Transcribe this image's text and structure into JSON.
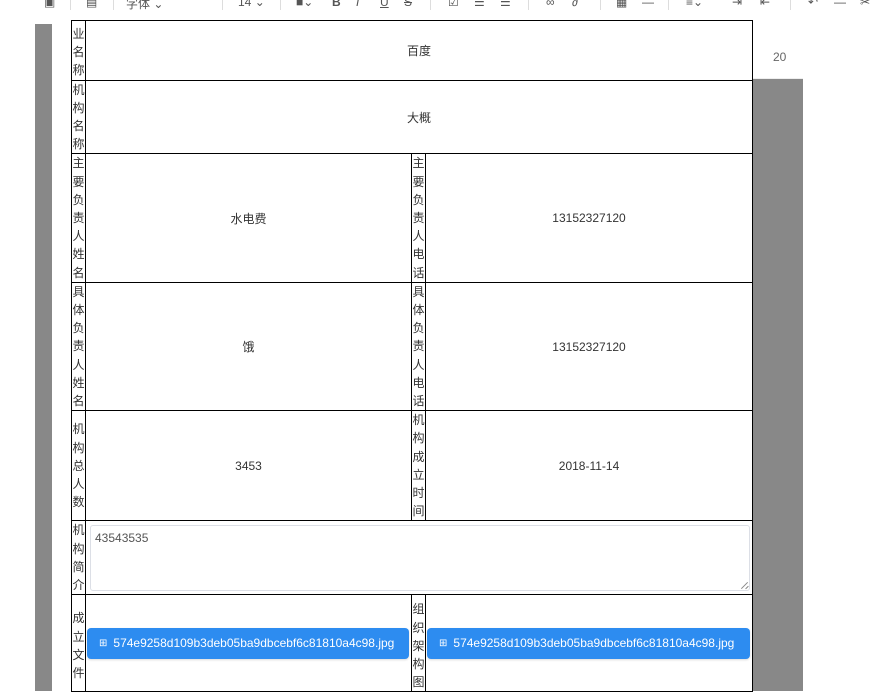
{
  "toolbar": {
    "font_label": "字体",
    "size_label": "14",
    "bold": "B",
    "italic": "I",
    "underline": "U",
    "strike": "S"
  },
  "background": {
    "fragment_text": "20"
  },
  "form": {
    "rows": {
      "business_name": {
        "label": "业名称",
        "value": "百度"
      },
      "org_name": {
        "label": "机构名称",
        "value": "大概"
      },
      "main_person": {
        "label": "主要负责人姓名",
        "value": "水电费",
        "phone_label": "主要负责人电话",
        "phone_value": "13152327120"
      },
      "specific_person": {
        "label": "具体负责人姓名",
        "value": "饿",
        "phone_label": "具体负责人电话",
        "phone_value": "13152327120"
      },
      "headcount": {
        "label": "机构总人数",
        "value": "3453",
        "date_label": "机构成立时间",
        "date_value": "2018-11-14"
      },
      "intro": {
        "label": "机构简介",
        "value": "43543535"
      },
      "files": {
        "founding_label": "成立文件",
        "founding_file": "574e9258d109b3deb05ba9dbcebf6c81810a4c98.jpg",
        "org_chart_label": "组织架构图",
        "org_chart_file": "574e9258d109b3deb05ba9dbcebf6c81810a4c98.jpg"
      }
    }
  }
}
